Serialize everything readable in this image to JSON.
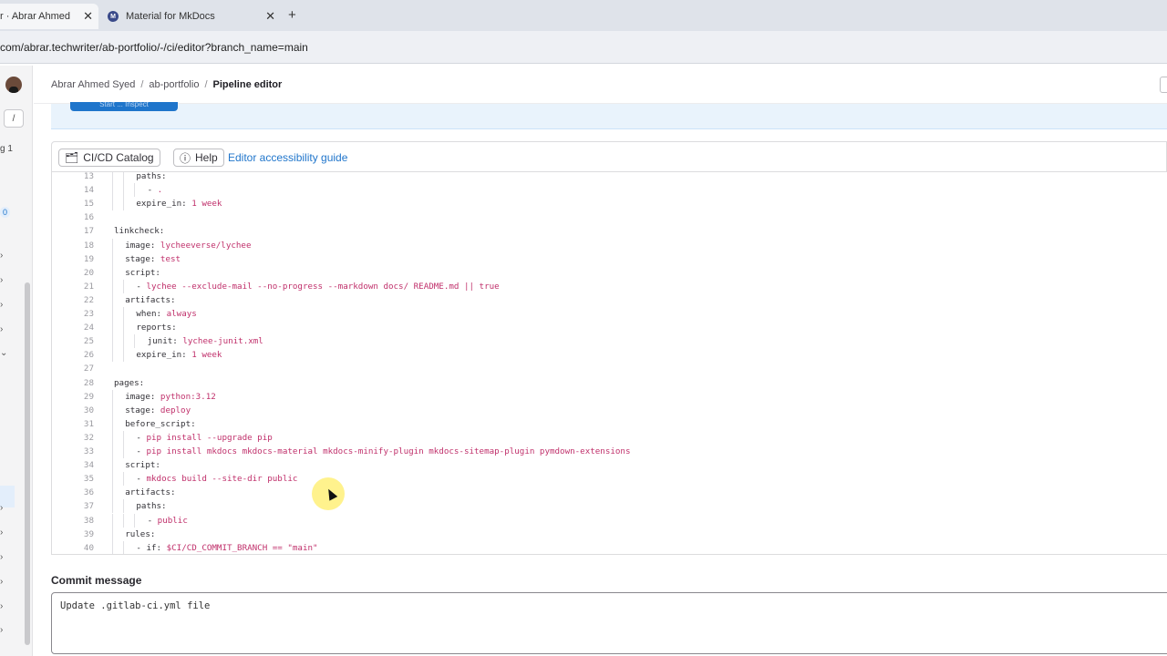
{
  "browser": {
    "tabs": [
      {
        "title": "r · Abrar Ahmed",
        "close": "✕"
      },
      {
        "title": "Material for MkDocs",
        "close": "✕",
        "favicon": "M"
      }
    ],
    "new_tab": "+",
    "url": "com/abrar.techwriter/ab-portfolio/-/ci/editor?branch_name=main"
  },
  "sidebar": {
    "items": [
      {
        "text": "g 1"
      },
      {
        "text": "0"
      }
    ]
  },
  "breadcrumb": [
    "Abrar Ahmed Syed",
    "ab-portfolio",
    "Pipeline editor"
  ],
  "banner": {
    "button": "Start ... Inspect"
  },
  "toolbar": {
    "catalog": "CI/CD Catalog",
    "help": "Help",
    "guide": "Editor accessibility guide"
  },
  "editor": {
    "lines": [
      {
        "n": "13",
        "indent": 2,
        "key": "paths:",
        "val": ""
      },
      {
        "n": "14",
        "indent": 3,
        "key": "- ",
        "val": "."
      },
      {
        "n": "15",
        "indent": 2,
        "key": "expire_in: ",
        "val": "1 week"
      },
      {
        "n": "16",
        "indent": 0,
        "key": "",
        "val": ""
      },
      {
        "n": "17",
        "indent": 0,
        "key": "linkcheck:",
        "val": ""
      },
      {
        "n": "18",
        "indent": 1,
        "key": "image: ",
        "val": "lycheeverse/lychee"
      },
      {
        "n": "19",
        "indent": 1,
        "key": "stage: ",
        "val": "test"
      },
      {
        "n": "20",
        "indent": 1,
        "key": "script:",
        "val": ""
      },
      {
        "n": "21",
        "indent": 2,
        "key": "- ",
        "val": "lychee --exclude-mail --no-progress --markdown docs/ README.md || true"
      },
      {
        "n": "22",
        "indent": 1,
        "key": "artifacts:",
        "val": ""
      },
      {
        "n": "23",
        "indent": 2,
        "key": "when: ",
        "val": "always"
      },
      {
        "n": "24",
        "indent": 2,
        "key": "reports:",
        "val": ""
      },
      {
        "n": "25",
        "indent": 3,
        "key": "junit: ",
        "val": "lychee-junit.xml"
      },
      {
        "n": "26",
        "indent": 2,
        "key": "expire_in: ",
        "val": "1 week"
      },
      {
        "n": "27",
        "indent": 0,
        "key": "",
        "val": ""
      },
      {
        "n": "28",
        "indent": 0,
        "key": "pages:",
        "val": ""
      },
      {
        "n": "29",
        "indent": 1,
        "key": "image: ",
        "val": "python:3.12"
      },
      {
        "n": "30",
        "indent": 1,
        "key": "stage: ",
        "val": "deploy"
      },
      {
        "n": "31",
        "indent": 1,
        "key": "before_script:",
        "val": ""
      },
      {
        "n": "32",
        "indent": 2,
        "key": "- ",
        "val": "pip install --upgrade pip"
      },
      {
        "n": "33",
        "indent": 2,
        "key": "- ",
        "val": "pip install mkdocs mkdocs-material mkdocs-minify-plugin mkdocs-sitemap-plugin pymdown-extensions"
      },
      {
        "n": "34",
        "indent": 1,
        "key": "script:",
        "val": ""
      },
      {
        "n": "35",
        "indent": 2,
        "key": "- ",
        "val": "mkdocs build --site-dir public"
      },
      {
        "n": "36",
        "indent": 1,
        "key": "artifacts:",
        "val": ""
      },
      {
        "n": "37",
        "indent": 2,
        "key": "paths:",
        "val": ""
      },
      {
        "n": "38",
        "indent": 3,
        "key": "- ",
        "val": "public"
      },
      {
        "n": "39",
        "indent": 1,
        "key": "rules:",
        "val": ""
      },
      {
        "n": "40",
        "indent": 2,
        "key": "- if: ",
        "val": "$CI/CD_COMMIT_BRANCH == \"main\""
      }
    ]
  },
  "commit": {
    "label": "Commit message",
    "value": "Update .gitlab-ci.yml file"
  },
  "colors": {
    "accent": "#1f75cb",
    "code_value": "#c0306b"
  }
}
